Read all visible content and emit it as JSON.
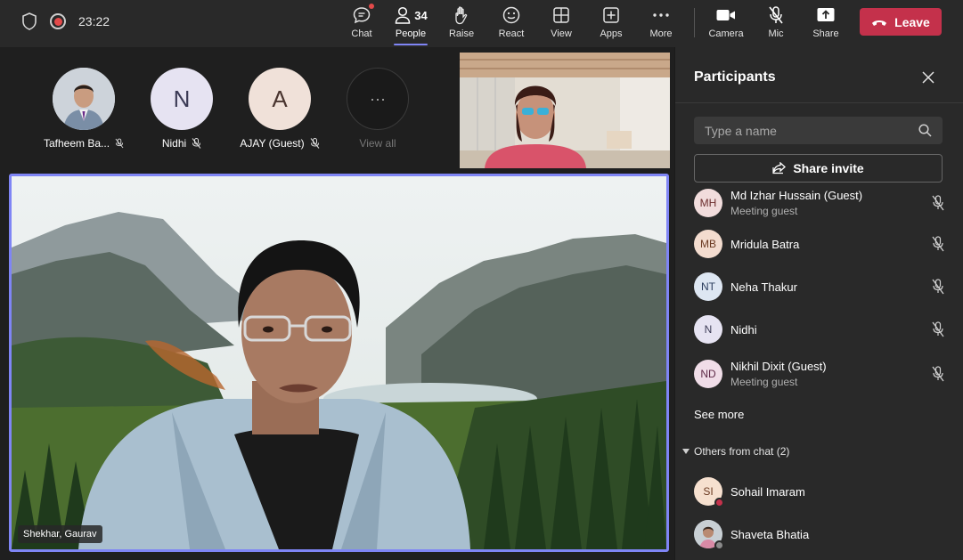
{
  "topbar": {
    "time": "23:22",
    "items": [
      {
        "label": "Chat"
      },
      {
        "label": "People",
        "count": "34"
      },
      {
        "label": "Raise"
      },
      {
        "label": "React"
      },
      {
        "label": "View"
      },
      {
        "label": "Apps"
      },
      {
        "label": "More"
      },
      {
        "label": "Camera"
      },
      {
        "label": "Mic"
      },
      {
        "label": "Share"
      }
    ],
    "leave_label": "Leave"
  },
  "stage": {
    "thumbnails": [
      {
        "name": "Tafheem Ba...",
        "initial": ""
      },
      {
        "name": "Nidhi",
        "initial": "N"
      },
      {
        "name": "AJAY (Guest)",
        "initial": "A"
      },
      {
        "name": "View all",
        "initial": "···"
      }
    ],
    "main_speaker": "Shekhar, Gaurav"
  },
  "panel": {
    "title": "Participants",
    "search_placeholder": "Type a name",
    "share_label": "Share invite",
    "participants": [
      {
        "initials": "MH",
        "name": "Md Izhar Hussain (Guest)",
        "sub": "Meeting guest"
      },
      {
        "initials": "MB",
        "name": "Mridula Batra",
        "sub": ""
      },
      {
        "initials": "NT",
        "name": "Neha Thakur",
        "sub": ""
      },
      {
        "initials": "N",
        "name": "Nidhi",
        "sub": ""
      },
      {
        "initials": "ND",
        "name": "Nikhil Dixit (Guest)",
        "sub": "Meeting guest"
      }
    ],
    "see_more": "See more",
    "others_header": "Others from chat (2)",
    "others": [
      {
        "initials": "SI",
        "name": "Sohail Imaram"
      },
      {
        "initials": "",
        "name": "Shaveta Bhatia"
      }
    ]
  },
  "colors": {
    "accent": "#7f85f5",
    "leave": "#c4314b",
    "recording": "#e34a4a"
  }
}
